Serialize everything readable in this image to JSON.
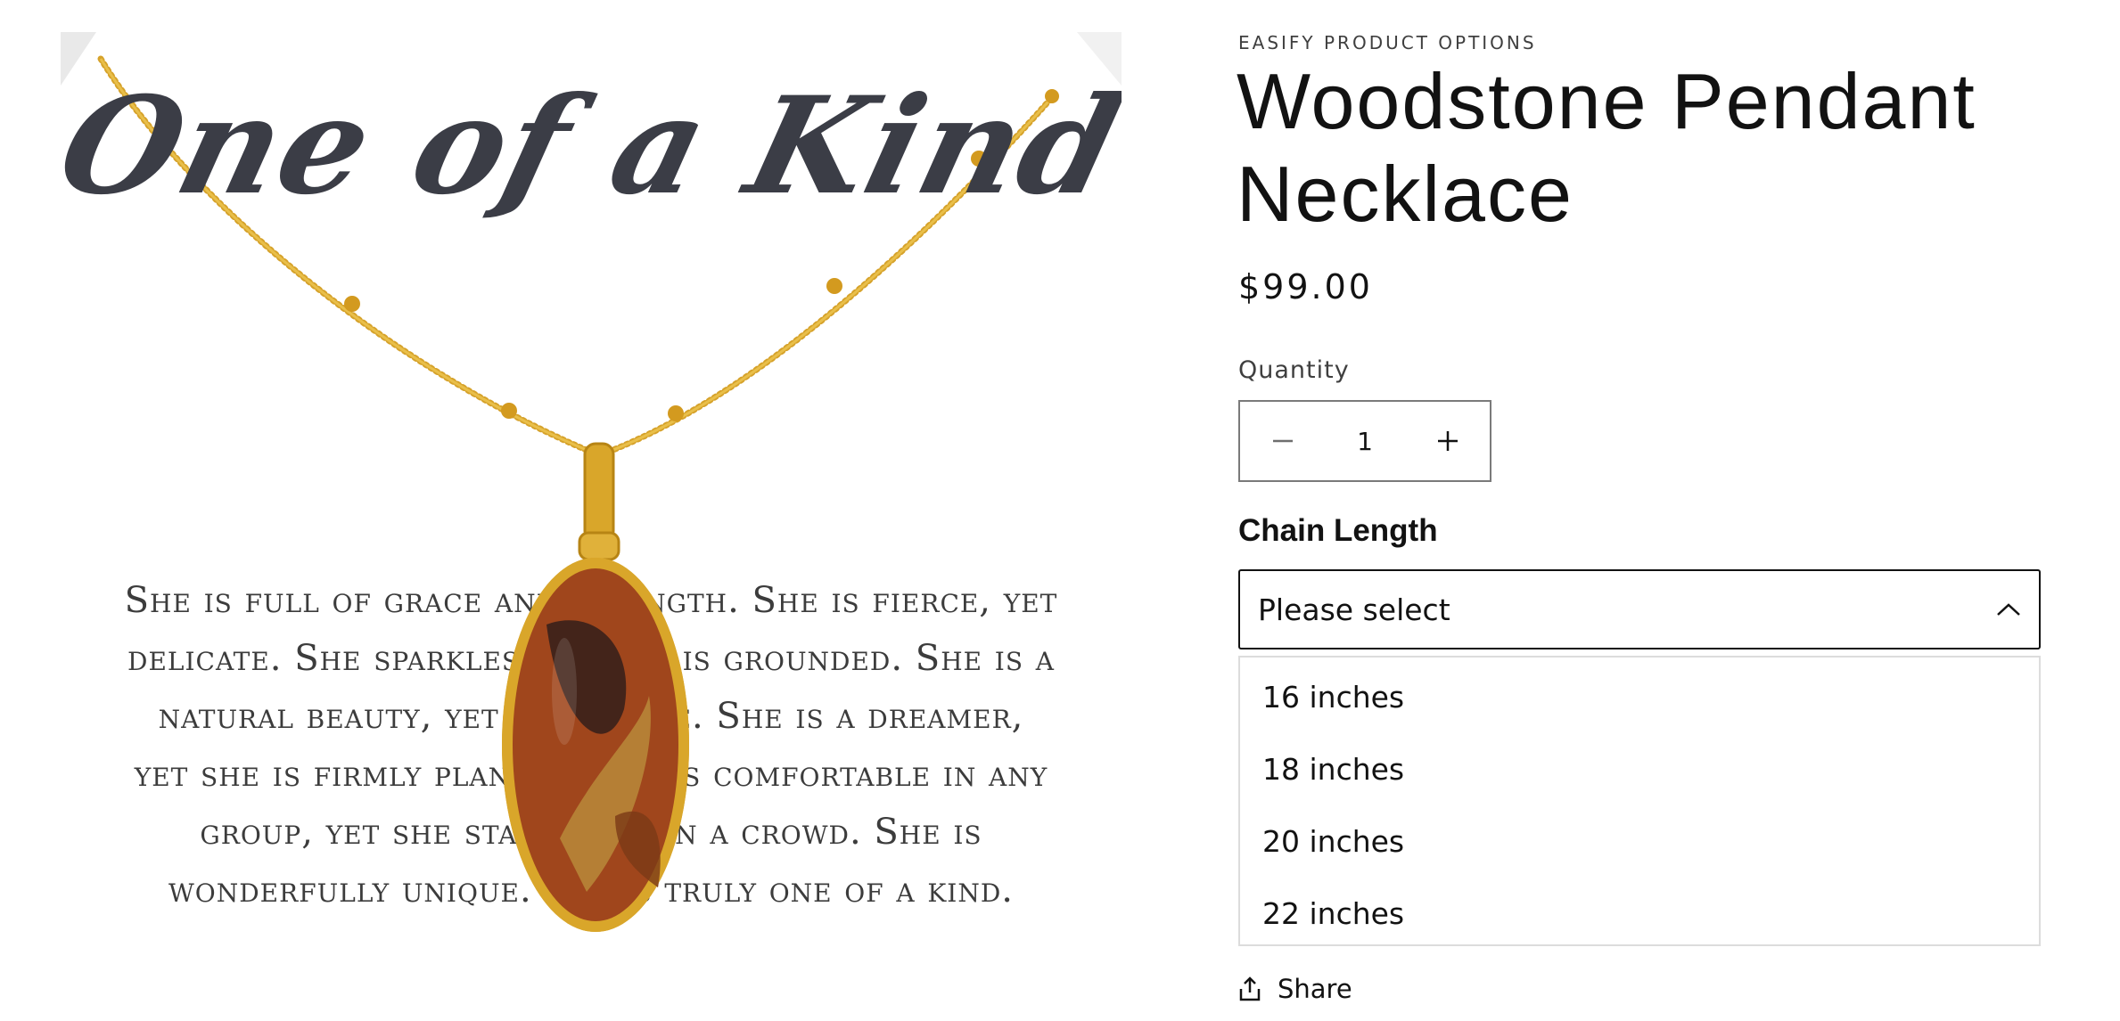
{
  "product": {
    "vendor": "EASIFY PRODUCT OPTIONS",
    "title": "Woodstone Pendant Necklace",
    "price": "$99.00",
    "image": {
      "script_text": "One of a Kind",
      "card_lines": [
        "She is full of grace and strength.  She is fierce, yet",
        "delicate. She sparkles, yet she is grounded. She is a",
        "natural beauty, yet so capable. She is a dreamer,",
        "yet she is firmly planted. She is comfortable in any",
        "group, yet she stands out in a crowd. She is",
        "wonderfully unique. She is truly one of a kind."
      ]
    }
  },
  "quantity": {
    "label": "Quantity",
    "value": "1",
    "decrease_icon": "minus-icon",
    "increase_icon": "plus-icon"
  },
  "chain_length": {
    "label": "Chain Length",
    "placeholder": "Please select",
    "options": [
      "16 inches",
      "18 inches",
      "20 inches",
      "22 inches"
    ],
    "chevron_icon": "chevron-up-icon"
  },
  "share": {
    "label": "Share",
    "icon": "share-icon"
  },
  "colors": {
    "gold": "#d9a62a",
    "stone": "#a0461c",
    "text": "#121212",
    "border": "#121212"
  }
}
